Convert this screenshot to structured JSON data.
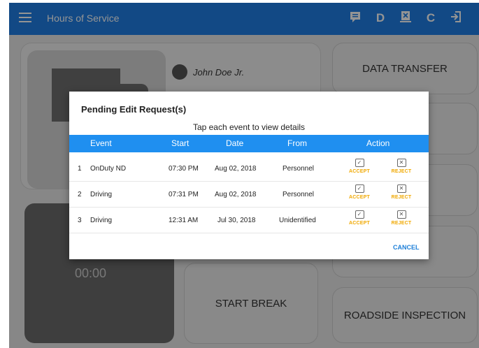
{
  "appbar": {
    "title": "Hours of Service",
    "icons": [
      "menu-icon",
      "message-icon",
      "d-icon",
      "certify-icon",
      "refresh-icon",
      "logout-icon"
    ],
    "d_label": "D",
    "refresh_label": "C"
  },
  "dashboard": {
    "driver_name": "John Doe Jr.",
    "buttons": {
      "data_transfer": "DATA TRANSFER",
      "start_break": "START BREAK",
      "roadside_inspection": "ROADSIDE INSPECTION"
    },
    "timer": "00:00"
  },
  "dialog": {
    "title": "Pending Edit Request(s)",
    "hint": "Tap each event to view details",
    "columns": [
      "Event",
      "Start",
      "Date",
      "From",
      "Action"
    ],
    "rows": [
      {
        "num": "1",
        "event": "OnDuty ND",
        "start": "07:30 PM",
        "date": "Aug 02, 2018",
        "from": "Personnel"
      },
      {
        "num": "2",
        "event": "Driving",
        "start": "07:31 PM",
        "date": "Aug 02, 2018",
        "from": "Personnel"
      },
      {
        "num": "3",
        "event": "Driving",
        "start": "12:31 AM",
        "date": "Jul 30, 2018",
        "from": "Unidentified"
      }
    ],
    "accept_label": "ACCEPT",
    "reject_label": "REJECT",
    "cancel_label": "CANCEL"
  },
  "colors": {
    "primary": "#1f7fe5",
    "header": "#1f8ff0",
    "accept": "#f0a800",
    "link": "#1d7fd8"
  }
}
